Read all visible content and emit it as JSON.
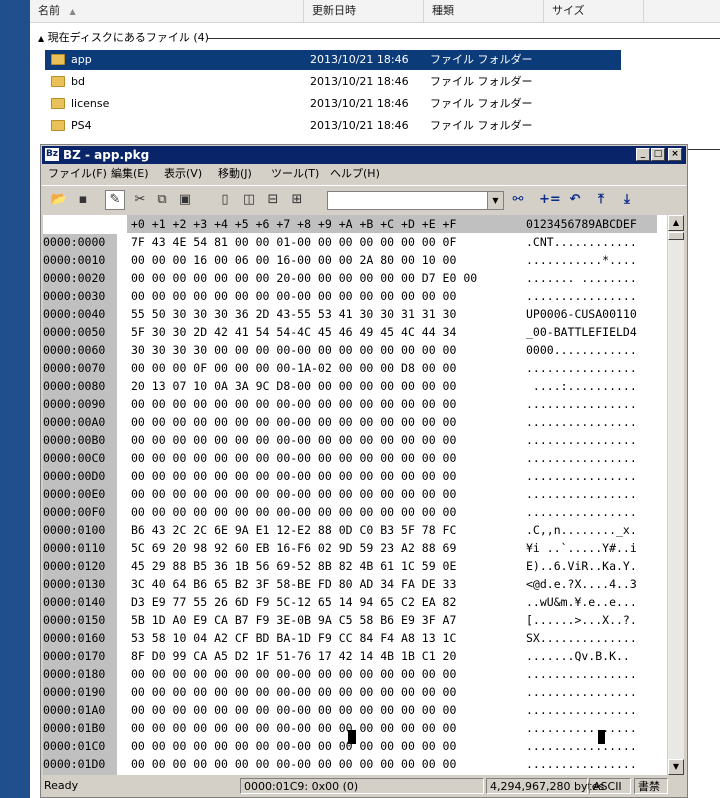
{
  "explorer": {
    "columns": {
      "name": "名前",
      "modified": "更新日時",
      "type": "種類",
      "size": "サイズ"
    },
    "group_header": "現在ディスクにあるファイル (4)",
    "files": [
      {
        "name": "app",
        "date": "2013/10/21 18:46",
        "type": "ファイル フォルダー",
        "selected": true
      },
      {
        "name": "bd",
        "date": "2013/10/21 18:46",
        "type": "ファイル フォルダー"
      },
      {
        "name": "license",
        "date": "2013/10/21 18:46",
        "type": "ファイル フォルダー"
      },
      {
        "name": "PS4",
        "date": "2013/10/21 18:46",
        "type": "ファイル フォルダー"
      }
    ]
  },
  "bz": {
    "logo": "Bz",
    "title": "BZ - app.pkg",
    "window_buttons": {
      "minimize": "_",
      "maximize": "□",
      "close": "×"
    },
    "menu": {
      "file": "ファイル(F)",
      "edit": "編集(E)",
      "view": "表示(V)",
      "move": "移動(J)",
      "tools": "ツール(T)",
      "help": "ヘルプ(H)"
    },
    "toolbar": {
      "combo_value": "",
      "combo_arrow": "▼"
    },
    "hex_header": "+0 +1 +2 +3 +4 +5 +6 +7 +8 +9 +A +B +C +D +E +F",
    "ascii_header": "0123456789ABCDEF",
    "rows": [
      {
        "addr": "0000:0000",
        "hex": "7F 43 4E 54 81 00 00 01-00 00 00 00 00 00 00 0F",
        "ascii": ".CNT............"
      },
      {
        "addr": "0000:0010",
        "hex": "00 00 00 16 00 06 00 16-00 00 00 2A 80 00 10 00",
        "ascii": "...........*...."
      },
      {
        "addr": "0000:0020",
        "hex": "00 00 00 00 00 00 00 20-00 00 00 00 00 00 D7 E0 00",
        "ascii": "....... ........"
      },
      {
        "addr": "0000:0030",
        "hex": "00 00 00 00 00 00 00 00-00 00 00 00 00 00 00 00",
        "ascii": "................"
      },
      {
        "addr": "0000:0040",
        "hex": "55 50 30 30 30 36 2D 43-55 53 41 30 30 31 31 30",
        "ascii": "UP0006-CUSA00110"
      },
      {
        "addr": "0000:0050",
        "hex": "5F 30 30 2D 42 41 54 54-4C 45 46 49 45 4C 44 34",
        "ascii": "_00-BATTLEFIELD4"
      },
      {
        "addr": "0000:0060",
        "hex": "30 30 30 30 00 00 00 00-00 00 00 00 00 00 00 00",
        "ascii": "0000............"
      },
      {
        "addr": "0000:0070",
        "hex": "00 00 00 0F 00 00 00 00-1A-02 00 00 00 D8 00 00",
        "ascii": "................"
      },
      {
        "addr": "0000:0080",
        "hex": "20 13 07 10 0A 3A 9C D8-00 00 00 00 00 00 00 00",
        "ascii": " ....:.........."
      },
      {
        "addr": "0000:0090",
        "hex": "00 00 00 00 00 00 00 00-00 00 00 00 00 00 00 00",
        "ascii": "................"
      },
      {
        "addr": "0000:00A0",
        "hex": "00 00 00 00 00 00 00 00-00 00 00 00 00 00 00 00",
        "ascii": "................"
      },
      {
        "addr": "0000:00B0",
        "hex": "00 00 00 00 00 00 00 00-00 00 00 00 00 00 00 00",
        "ascii": "................"
      },
      {
        "addr": "0000:00C0",
        "hex": "00 00 00 00 00 00 00 00-00 00 00 00 00 00 00 00",
        "ascii": "................"
      },
      {
        "addr": "0000:00D0",
        "hex": "00 00 00 00 00 00 00 00-00 00 00 00 00 00 00 00",
        "ascii": "................"
      },
      {
        "addr": "0000:00E0",
        "hex": "00 00 00 00 00 00 00 00-00 00 00 00 00 00 00 00",
        "ascii": "................"
      },
      {
        "addr": "0000:00F0",
        "hex": "00 00 00 00 00 00 00 00-00 00 00 00 00 00 00 00",
        "ascii": "................"
      },
      {
        "addr": "0000:0100",
        "hex": "B6 43 2C 2C 6E 9A E1 12-E2 88 0D C0 B3 5F 78 FC",
        "ascii": ".C,,n........_x."
      },
      {
        "addr": "0000:0110",
        "hex": "5C 69 20 98 92 60 EB 16-F6 02 9D 59 23 A2 88 69",
        "ascii": "¥i ..`.....Y#..i"
      },
      {
        "addr": "0000:0120",
        "hex": "45 29 88 B5 36 1B 56 69-52 8B 82 4B 61 1C 59 0E",
        "ascii": "E)..6.ViR..Ka.Y."
      },
      {
        "addr": "0000:0130",
        "hex": "3C 40 64 B6 65 B2 3F 58-BE FD 80 AD 34 FA DE 33",
        "ascii": "<@d.e.?X....4..3"
      },
      {
        "addr": "0000:0140",
        "hex": "D3 E9 77 55 26 6D F9 5C-12 65 14 94 65 C2 EA 82",
        "ascii": "..wU&m.¥.e..e..."
      },
      {
        "addr": "0000:0150",
        "hex": "5B 1D A0 E9 CA B7 F9 3E-0B 9A C5 58 B6 E9 3F A7",
        "ascii": "[......>...X..?."
      },
      {
        "addr": "0000:0160",
        "hex": "53 58 10 04 A2 CF BD BA-1D F9 CC 84 F4 A8 13 1C",
        "ascii": "SX.............."
      },
      {
        "addr": "0000:0170",
        "hex": "8F D0 99 CA A5 D2 1F 51-76 17 42 14 4B 1B C1 20",
        "ascii": ".......Qv.B.K.. "
      },
      {
        "addr": "0000:0180",
        "hex": "00 00 00 00 00 00 00 00-00 00 00 00 00 00 00 00",
        "ascii": "................"
      },
      {
        "addr": "0000:0190",
        "hex": "00 00 00 00 00 00 00 00-00 00 00 00 00 00 00 00",
        "ascii": "................"
      },
      {
        "addr": "0000:01A0",
        "hex": "00 00 00 00 00 00 00 00-00 00 00 00 00 00 00 00",
        "ascii": "................"
      },
      {
        "addr": "0000:01B0",
        "hex": "00 00 00 00 00 00 00 00-00 00 00 00 00 00 00 00",
        "ascii": "................"
      },
      {
        "addr": "0000:01C0",
        "hex": "00 00 00 00 00 00 00 00-00 00 00 00 00 00 00 00",
        "ascii": "................"
      },
      {
        "addr": "0000:01D0",
        "hex": "00 00 00 00 00 00 00 00-00 00 00 00 00 00 00 00",
        "ascii": "................"
      }
    ],
    "status": {
      "state": "Ready",
      "position": "0000:01C9: 0x00 (0)",
      "size": "4,294,967,280 bytes",
      "encoding": "ASCII",
      "mode": "書禁"
    },
    "colors": {
      "titlebar": "#0a246a",
      "selection": "#0c3b7a",
      "address_bg": "#c0c0c0"
    }
  }
}
